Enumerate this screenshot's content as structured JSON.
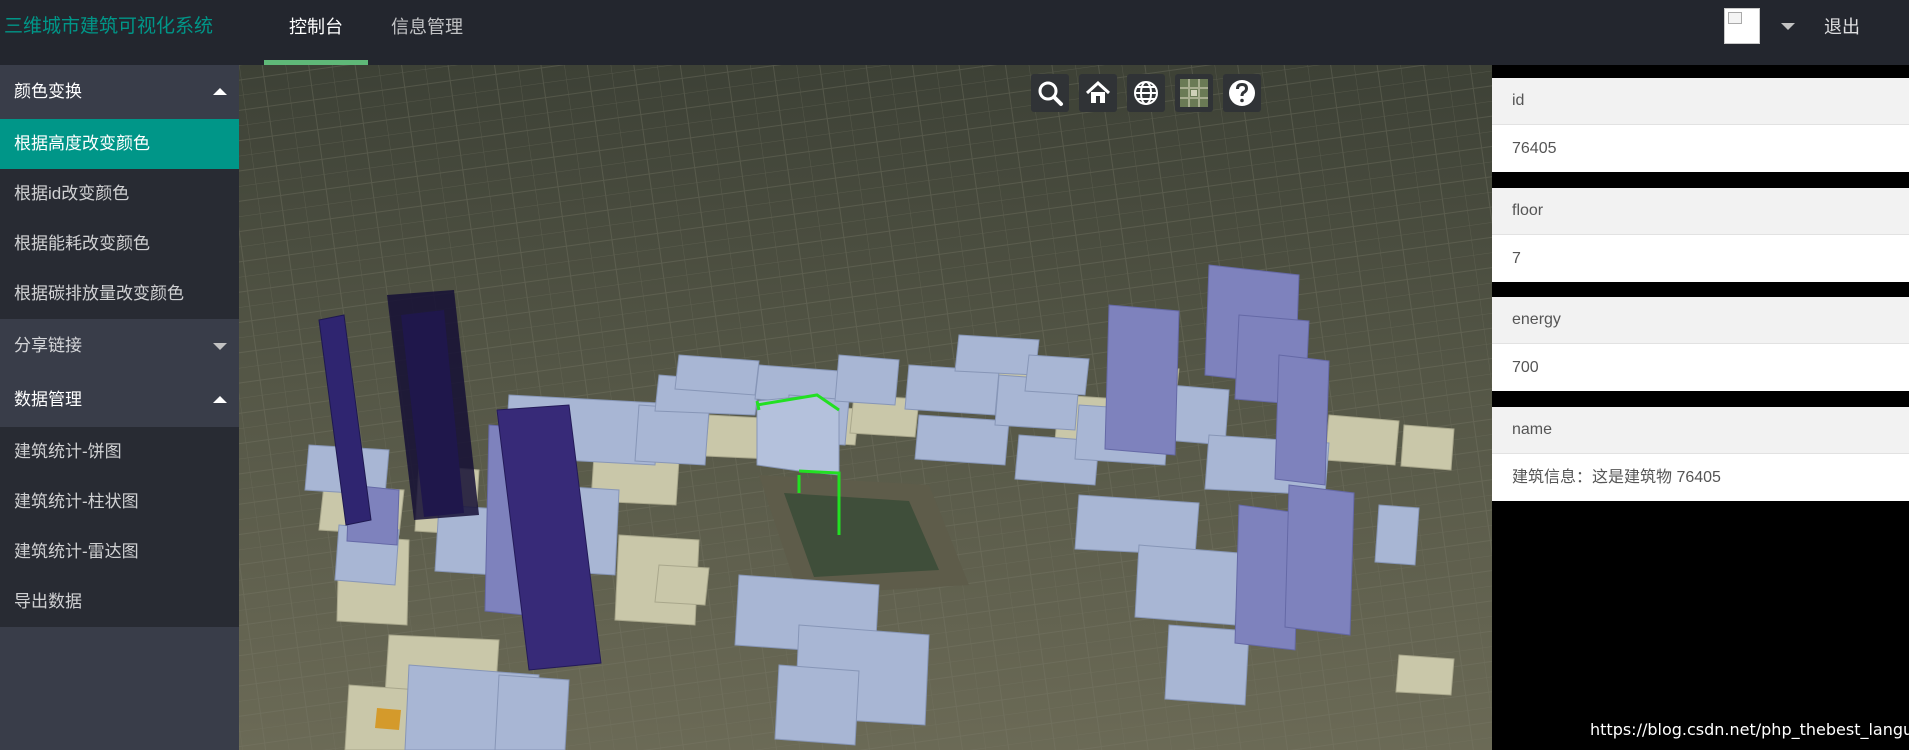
{
  "header": {
    "app_title": "三维城市建筑可视化系统",
    "tabs": [
      {
        "label": "控制台",
        "active": true
      },
      {
        "label": "信息管理",
        "active": false
      }
    ],
    "logout_label": "退出"
  },
  "sidebar": {
    "groups": [
      {
        "label": "颜色变换",
        "expanded": true,
        "items": [
          {
            "label": "根据高度改变颜色",
            "active": true
          },
          {
            "label": "根据id改变颜色",
            "active": false
          },
          {
            "label": "根据能耗改变颜色",
            "active": false
          },
          {
            "label": "根据碳排放量改变颜色",
            "active": false
          }
        ]
      },
      {
        "label": "分享链接",
        "expanded": false,
        "items": []
      },
      {
        "label": "数据管理",
        "expanded": true,
        "items": [
          {
            "label": "建筑统计-饼图",
            "active": false
          },
          {
            "label": "建筑统计-柱状图",
            "active": false
          },
          {
            "label": "建筑统计-雷达图",
            "active": false
          },
          {
            "label": "导出数据",
            "active": false
          }
        ]
      }
    ]
  },
  "map_toolbar": [
    "search-icon",
    "home-icon",
    "globe-icon",
    "imagery-layer-icon",
    "help-icon"
  ],
  "properties": [
    {
      "key": "id",
      "value": "76405"
    },
    {
      "key": "floor",
      "value": "7"
    },
    {
      "key": "energy",
      "value": "700"
    },
    {
      "key": "name",
      "value": "建筑信息：这是建筑物 76405"
    }
  ],
  "watermark": "https://blog.csdn.net/php_thebest_language",
  "colors": {
    "accent": "#009688",
    "tab_underline": "#5fb878",
    "header_bg": "#23262e",
    "sidebar_bg": "#393d49",
    "sidebar_sub_bg": "#282b33",
    "building_low": "#a9b8d6",
    "building_mid": "#7f83bd",
    "building_high": "#34266f",
    "selection": "#22e022"
  }
}
